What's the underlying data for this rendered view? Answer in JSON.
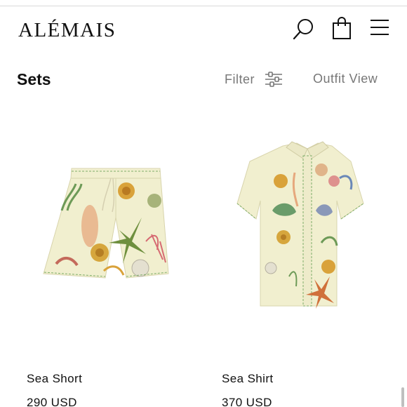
{
  "header": {
    "logo": "ALÉMAIS",
    "icons": [
      "search-icon",
      "shopping-bag-icon",
      "menu-icon"
    ]
  },
  "toolbar": {
    "title": "Sets",
    "filter_label": "Filter",
    "filter_icon": "sliders-icon",
    "outfit_view_label": "Outfit View"
  },
  "products": [
    {
      "name": "Sea Short",
      "price": "290 USD"
    },
    {
      "name": "Sea Shirt",
      "price": "370 USD"
    }
  ],
  "colors": {
    "fabric": "#f1efcf",
    "text": "#111111",
    "muted_text": "#777777"
  }
}
